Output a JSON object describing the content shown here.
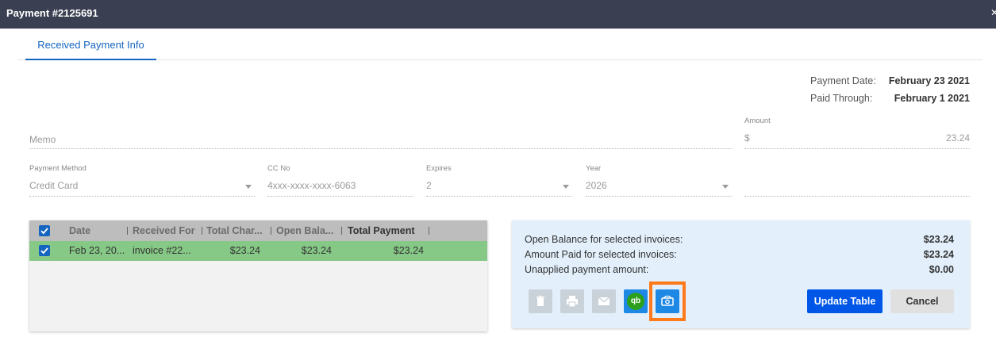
{
  "window": {
    "title": "Payment #2125691"
  },
  "tabs": [
    {
      "label": "Received Payment Info"
    }
  ],
  "meta": {
    "payment_date_label": "Payment Date:",
    "payment_date_value": "February 23 2021",
    "paid_through_label": "Paid Through:",
    "paid_through_value": "February 1 2021"
  },
  "form": {
    "memo": {
      "placeholder": "Memo",
      "value": ""
    },
    "amount": {
      "label": "Amount",
      "prefix": "$",
      "value": "23.24"
    },
    "payment_method": {
      "label": "Payment Method",
      "value": "Credit Card"
    },
    "cc_no": {
      "label": "CC No",
      "value": "4xxx-xxxx-xxxx-6063"
    },
    "expires": {
      "label": "Expires",
      "value": "2"
    },
    "year": {
      "label": "Year",
      "value": "2026"
    }
  },
  "grid": {
    "columns": [
      "Date",
      "Received For",
      "Total Char...",
      "Open Bala...",
      "Total Payment"
    ],
    "rows": [
      {
        "date": "Feb 23, 20...",
        "received_for": "invoice #22...",
        "total_charge": "$23.24",
        "open_balance": "$23.24",
        "total_payment": "$23.24",
        "checked": true
      }
    ]
  },
  "summary": {
    "open_balance_label": "Open Balance for selected invoices:",
    "open_balance_value": "$23.24",
    "amount_paid_label": "Amount Paid for selected invoices:",
    "amount_paid_value": "$23.24",
    "unapplied_label": "Unapplied payment amount:",
    "unapplied_value": "$0.00"
  },
  "actions": {
    "icons": [
      "trash-icon",
      "print-icon",
      "email-icon",
      "quickbooks-icon",
      "payment-icon"
    ],
    "quickbooks_mark": "qb",
    "update_label": "Update Table",
    "cancel_label": "Cancel"
  },
  "colors": {
    "titlebar": "#3a3f51",
    "accent": "#1565c0",
    "row_selected": "#86c886",
    "summary_bg": "#e3f0fb",
    "primary_button": "#0057e7",
    "highlight": "#ff7a1a",
    "quickbooks_green": "#2ca01c"
  }
}
